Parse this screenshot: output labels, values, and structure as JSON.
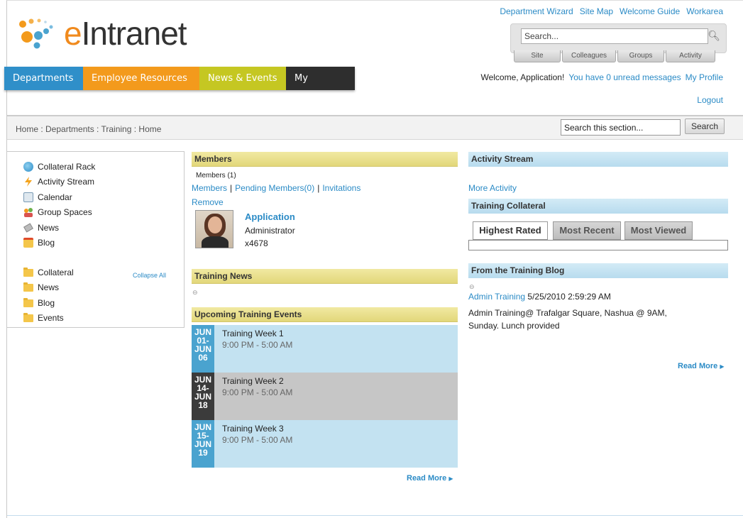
{
  "header": {
    "logo_text_e": "e",
    "logo_text_rest": "Intranet",
    "top_links": [
      "Department Wizard",
      "Site Map",
      "Welcome Guide",
      "Workarea"
    ],
    "search_placeholder": "Search...",
    "search_tabs": [
      "Site",
      "Colleagues",
      "Groups",
      "Activity"
    ],
    "nav": [
      "Departments",
      "Employee Resources",
      "News & Events",
      "My Intranet"
    ],
    "welcome_text": "Welcome, Application!",
    "unread_link": "You have 0 unread messages",
    "profile_link": "My Profile",
    "logout_link": "Logout"
  },
  "breadcrumb": {
    "text": "Home : Departments : Training : Home",
    "section_search_value": "Search this section...",
    "search_button": "Search"
  },
  "sidebar": {
    "items": [
      {
        "label": "Collateral Rack",
        "icon": "collateral-rack-icon"
      },
      {
        "label": "Activity Stream",
        "icon": "activity-stream-icon"
      },
      {
        "label": "Calendar",
        "icon": "calendar-icon"
      },
      {
        "label": "Group Spaces",
        "icon": "group-spaces-icon"
      },
      {
        "label": "News",
        "icon": "news-icon"
      },
      {
        "label": "Blog",
        "icon": "blog-icon"
      }
    ],
    "folders": [
      "Collateral",
      "News",
      "Blog",
      "Events"
    ],
    "collapse_all": "Collapse All"
  },
  "members": {
    "title": "Members",
    "count_text": "Members (1)",
    "link_members": "Members",
    "link_pending": "Pending Members(0)",
    "link_invitations": "Invitations",
    "sep": "|",
    "remove": "Remove",
    "person": {
      "name": "Application",
      "role": "Administrator",
      "ext": "x4678"
    }
  },
  "training_news": {
    "title": "Training News"
  },
  "events": {
    "title": "Upcoming Training Events",
    "items": [
      {
        "date_lines": [
          "JUN",
          "01-",
          "JUN",
          "06"
        ],
        "title": "Training Week 1",
        "time": "9:00 PM - 5:00 AM",
        "date_color": "#4aa3cf",
        "bg": "#c3e2f1"
      },
      {
        "date_lines": [
          "JUN",
          "14-",
          "JUN",
          "18"
        ],
        "title": "Training Week 2",
        "time": "9:00 PM - 5:00 AM",
        "date_color": "#3b3b3b",
        "bg": "#c6c6c6"
      },
      {
        "date_lines": [
          "JUN",
          "15-",
          "JUN",
          "19"
        ],
        "title": "Training Week 3",
        "time": "9:00 PM - 5:00 AM",
        "date_color": "#4aa3cf",
        "bg": "#c3e2f1"
      }
    ],
    "read_more": "Read More"
  },
  "activity": {
    "title": "Activity Stream",
    "more_link": "More Activity"
  },
  "collateral": {
    "title": "Training Collateral",
    "tabs": [
      "Highest Rated",
      "Most Recent",
      "Most Viewed"
    ]
  },
  "blog": {
    "title": "From the Training Blog",
    "author": "Admin Training",
    "date": "5/25/2010 2:59:29 AM",
    "body_line1": "Admin Training@ Trafalgar Square, Nashua @ 9AM,",
    "body_line2": "Sunday. Lunch provided",
    "read_more": "Read More"
  }
}
